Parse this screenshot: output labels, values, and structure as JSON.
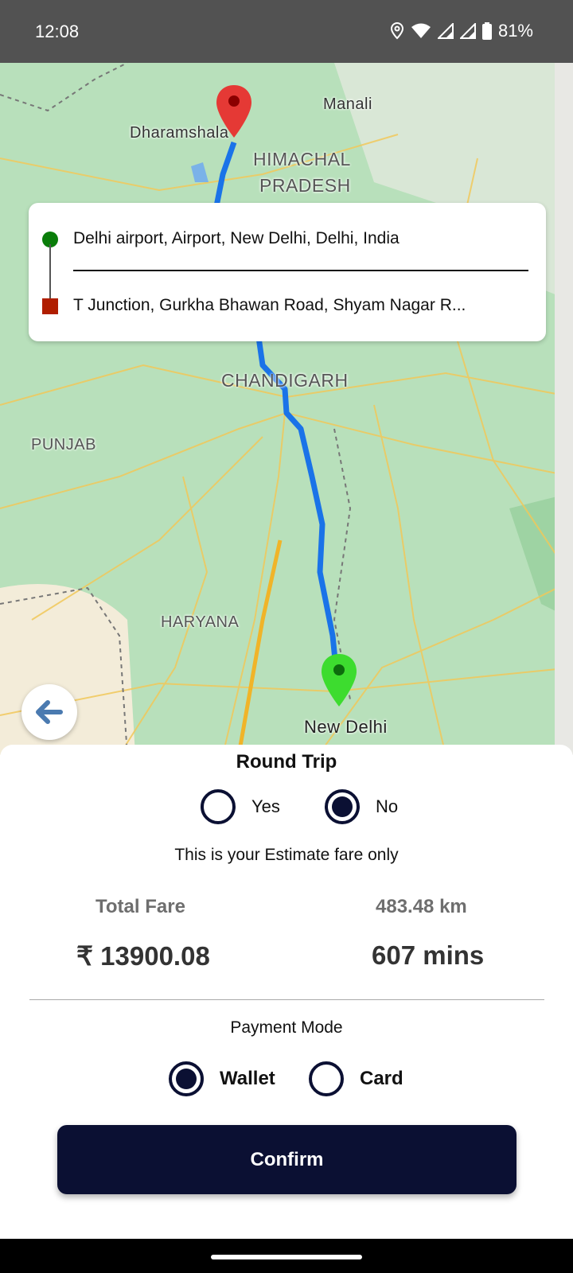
{
  "status_bar": {
    "time": "12:08",
    "battery": "81%",
    "icons": [
      "location-icon",
      "wifi-icon",
      "signal-icon",
      "signal-icon",
      "battery-icon"
    ]
  },
  "map": {
    "labels": {
      "dharamshala": "Dharamshala",
      "manali": "Manali",
      "himachal": "HIMACHAL",
      "pradesh": "PRADESH",
      "chandigarh": "CHANDIGARH",
      "punjab": "PUNJAB",
      "haryana": "HARYANA",
      "new_delhi": "New Delhi"
    },
    "route_color": "#1a73e8",
    "origin_pin_color": "#3ddc2f",
    "destination_pin_color": "#e53935"
  },
  "address_card": {
    "pickup": "Delhi airport, Airport, New Delhi, Delhi, India",
    "drop": "T Junction, Gurkha Bhawan Road, Shyam Nagar R..."
  },
  "sheet": {
    "round_trip_title": "Round Trip",
    "round_trip_options": [
      {
        "label": "Yes",
        "selected": false
      },
      {
        "label": "No",
        "selected": true
      }
    ],
    "estimate_note": "This is your Estimate fare only",
    "total_fare_label": "Total Fare",
    "total_fare_value": "₹ 13900.08",
    "distance": "483.48 km",
    "duration": "607 mins",
    "payment_mode_title": "Payment Mode",
    "payment_options": [
      {
        "label": "Wallet",
        "selected": true
      },
      {
        "label": "Card",
        "selected": false
      }
    ],
    "confirm_label": "Confirm"
  },
  "colors": {
    "primary": "#0b1033"
  }
}
